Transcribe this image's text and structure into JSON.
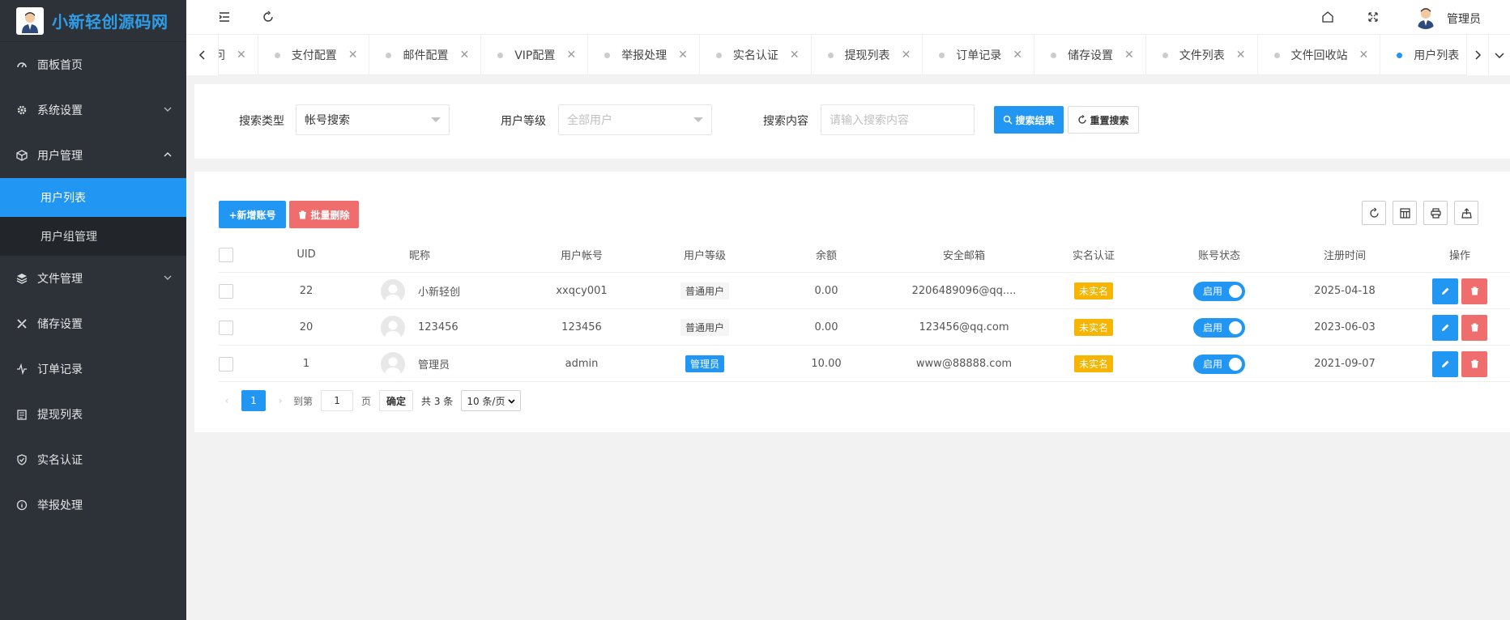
{
  "brand": {
    "name": "小新轻创源码网"
  },
  "sidebar": {
    "items": [
      {
        "label": "面板首页",
        "icon": "dashboard-icon"
      },
      {
        "label": "系统设置",
        "icon": "gear-icon"
      },
      {
        "label": "用户管理",
        "icon": "cube-icon"
      },
      {
        "label": "文件管理",
        "icon": "layers-icon"
      },
      {
        "label": "储存设置",
        "icon": "tools-icon"
      },
      {
        "label": "订单记录",
        "icon": "pulse-icon"
      },
      {
        "label": "提现列表",
        "icon": "clipboard-icon"
      },
      {
        "label": "实名认证",
        "icon": "shield-check-icon"
      },
      {
        "label": "举报处理",
        "icon": "info-circle-icon"
      }
    ],
    "sub": [
      {
        "label": "用户列表"
      },
      {
        "label": "用户组管理"
      }
    ]
  },
  "header": {
    "user_name": "管理员"
  },
  "tabs": [
    {
      "label": "访问"
    },
    {
      "label": "支付配置"
    },
    {
      "label": "邮件配置"
    },
    {
      "label": "VIP配置"
    },
    {
      "label": "举报处理"
    },
    {
      "label": "实名认证"
    },
    {
      "label": "提现列表"
    },
    {
      "label": "订单记录"
    },
    {
      "label": "储存设置"
    },
    {
      "label": "文件列表"
    },
    {
      "label": "文件回收站"
    },
    {
      "label": "用户列表"
    }
  ],
  "search": {
    "type_label": "搜索类型",
    "type_value": "帐号搜索",
    "level_label": "用户等级",
    "level_placeholder": "全部用户",
    "content_label": "搜索内容",
    "content_placeholder": "请输入搜索内容",
    "search_button": "搜索结果",
    "reset_button": "重置搜索"
  },
  "toolbar": {
    "add_button": "+新增账号",
    "batch_delete_button": "批量删除"
  },
  "table": {
    "headers": [
      "UID",
      "昵称",
      "用户帐号",
      "用户等级",
      "余额",
      "安全邮箱",
      "实名认证",
      "账号状态",
      "注册时间",
      "操作"
    ],
    "rows": [
      {
        "uid": "22",
        "nickname": "小新轻创",
        "account": "xxqcy001",
        "level": "普通用户",
        "level_type": "normal",
        "balance": "0.00",
        "email": "2206489096@qq....",
        "realname": "未实名",
        "status": "启用",
        "reg_time": "2025-04-18"
      },
      {
        "uid": "20",
        "nickname": "123456",
        "account": "123456",
        "level": "普通用户",
        "level_type": "normal",
        "balance": "0.00",
        "email": "123456@qq.com",
        "realname": "未实名",
        "status": "启用",
        "reg_time": "2023-06-03"
      },
      {
        "uid": "1",
        "nickname": "管理员",
        "account": "admin",
        "level": "管理员",
        "level_type": "admin",
        "balance": "10.00",
        "email": "www@88888.com",
        "realname": "未实名",
        "status": "启用",
        "reg_time": "2021-09-07"
      }
    ]
  },
  "pager": {
    "current": "1",
    "goto_label": "到第",
    "goto_value": "1",
    "page_unit": "页",
    "confirm": "确定",
    "total": "共 3 条",
    "page_size": "10 条/页"
  }
}
